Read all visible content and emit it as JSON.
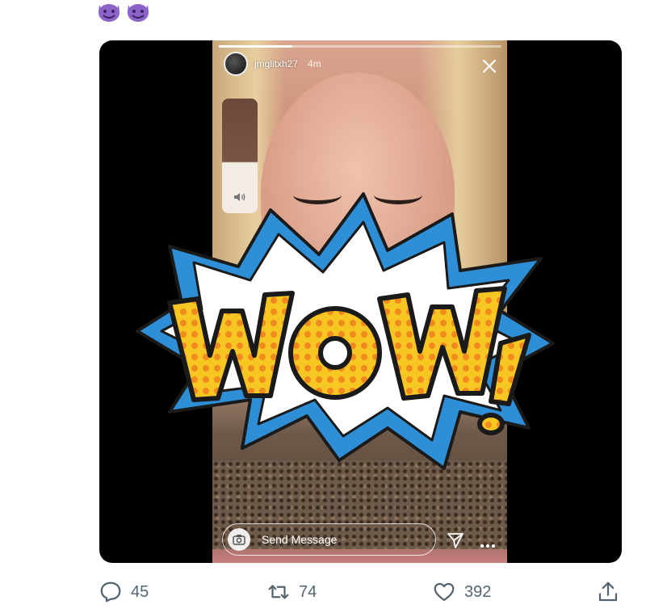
{
  "header": {
    "emoji_icons": [
      "smiling-devil-icon",
      "smiling-devil-icon"
    ],
    "emoji_color": "#8b63c9"
  },
  "story": {
    "username": "jmglitxh27",
    "time": "4m",
    "progress": 0.26,
    "send_placeholder": "Send Message",
    "close_icon": "close-icon",
    "sound_icon": "speaker-icon",
    "camera_icon": "camera-icon",
    "dm_icon": "paper-plane-icon",
    "more_icon": "more-icon"
  },
  "sticker": {
    "text": "WOW!",
    "colors": {
      "burst_outer": "#2f8fd6",
      "burst_inner": "#ffffff",
      "letter_fill": "#f7c623",
      "dots": "#f08a1c",
      "outline": "#1a1a1a"
    }
  },
  "actions": {
    "replies": "45",
    "retweets": "74",
    "likes": "392",
    "accent": "#536471"
  }
}
